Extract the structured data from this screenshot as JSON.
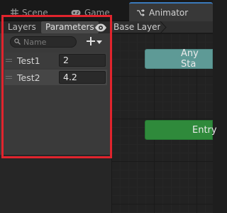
{
  "tabs": {
    "scene": {
      "label": "Scene",
      "icon": "grid-icon"
    },
    "game": {
      "label": "Game",
      "icon": "gamepad-icon"
    },
    "animator": {
      "label": "Animator",
      "icon": "animator-icon",
      "active": true
    }
  },
  "left_panel": {
    "tabs": [
      "Layers",
      "Parameters"
    ],
    "active_tab": "Parameters",
    "search": {
      "placeholder": "Name",
      "value": ""
    },
    "parameters": [
      {
        "name": "Test1",
        "value": "2"
      },
      {
        "name": "Test2",
        "value": "4.2"
      }
    ]
  },
  "graph": {
    "breadcrumb": "Base Layer",
    "nodes": [
      {
        "label": "Any Sta",
        "color": "#5e9a96"
      },
      {
        "label": "Entry",
        "color": "#2f8a3b"
      }
    ]
  },
  "colors": {
    "highlight": "#e0242d",
    "active_tab_accent": "#3a79bb"
  }
}
